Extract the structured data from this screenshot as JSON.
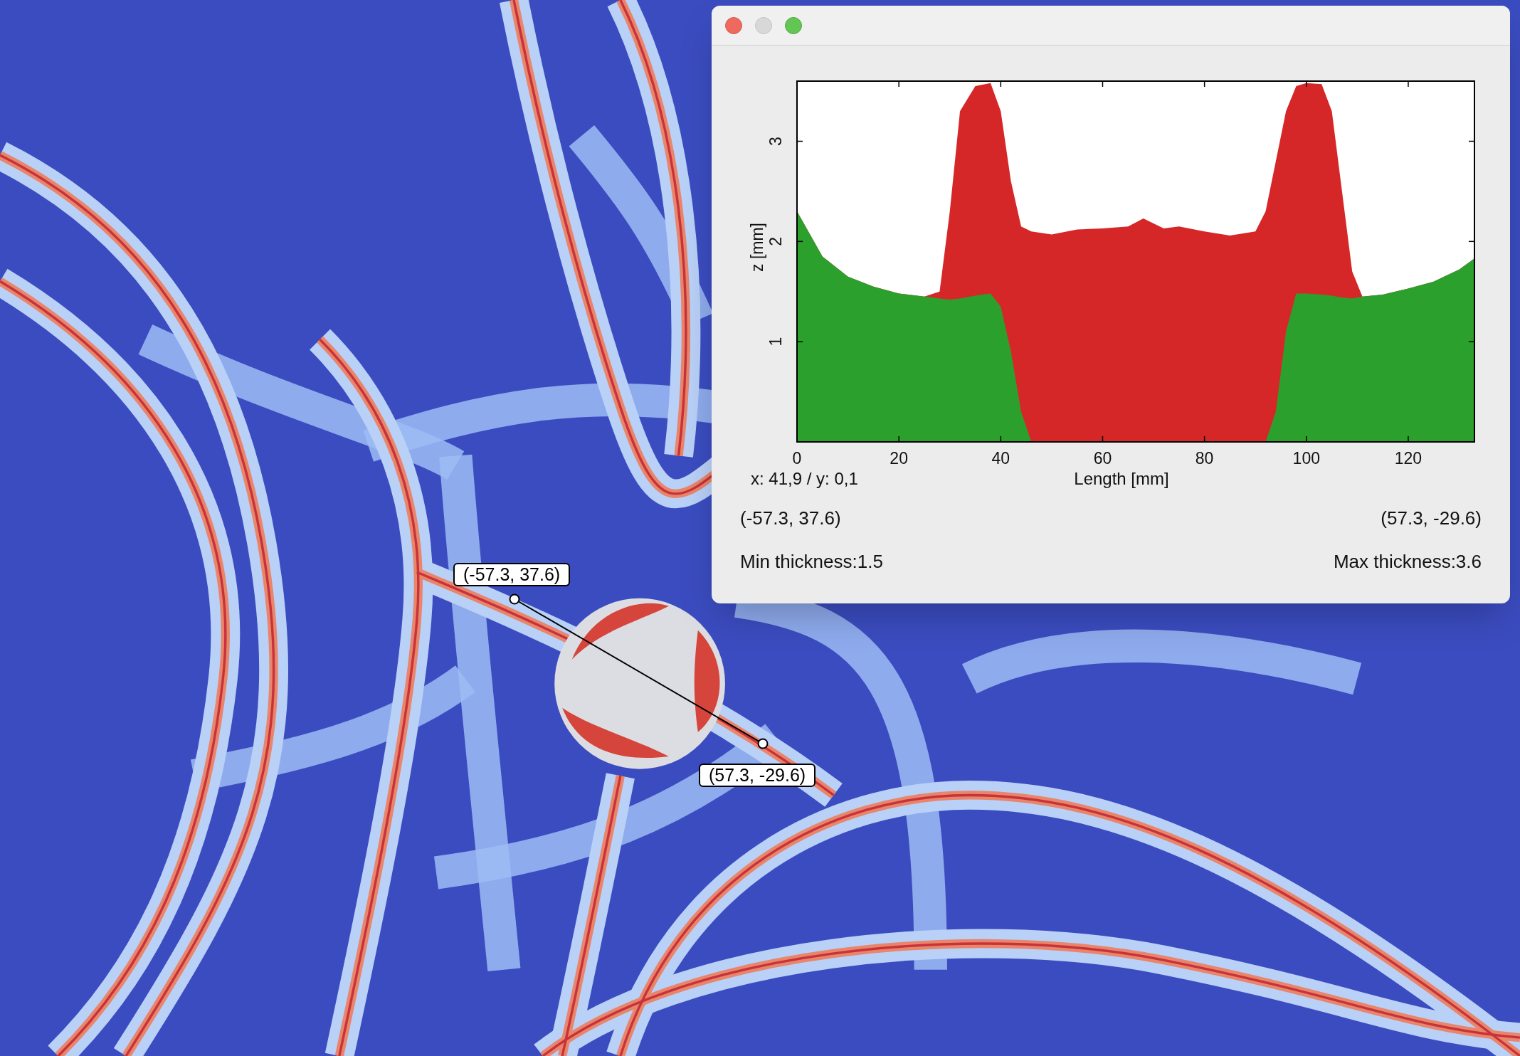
{
  "canvas": {
    "probe": {
      "start_label": "(-57.3, 37.6)",
      "end_label": "(57.3, -29.6)"
    }
  },
  "window": {
    "chart": {
      "chart_data": {
        "type": "area",
        "xlabel": "Length [mm]",
        "ylabel": "z [mm]",
        "xlim": [
          0,
          133
        ],
        "ylim": [
          0,
          3.6
        ],
        "xticks": [
          0,
          20,
          40,
          60,
          80,
          100,
          120
        ],
        "yticks": [
          1,
          2,
          3
        ],
        "x": [
          0,
          5,
          10,
          15,
          20,
          25,
          28,
          30,
          32,
          35,
          38,
          40,
          42,
          44,
          46,
          50,
          55,
          60,
          65,
          68,
          72,
          75,
          80,
          85,
          90,
          92,
          94,
          96,
          98,
          100,
          103,
          105,
          107,
          109,
          111,
          115,
          120,
          125,
          130,
          133
        ],
        "series": [
          {
            "color": "#d62728",
            "values": [
              2.3,
              1.85,
              1.65,
              1.55,
              1.48,
              1.45,
              1.5,
              2.3,
              3.3,
              3.55,
              3.58,
              3.3,
              2.6,
              2.15,
              2.1,
              2.07,
              2.12,
              2.13,
              2.15,
              2.23,
              2.13,
              2.15,
              2.1,
              2.06,
              2.1,
              2.3,
              2.8,
              3.3,
              3.55,
              3.58,
              3.57,
              3.3,
              2.5,
              1.7,
              1.45,
              1.47,
              1.53,
              1.6,
              1.72,
              1.83
            ]
          },
          {
            "color": "#2ca02c",
            "values": [
              2.3,
              1.85,
              1.65,
              1.55,
              1.48,
              1.45,
              1.43,
              1.42,
              1.43,
              1.46,
              1.48,
              1.35,
              0.9,
              0.3,
              0,
              0,
              0,
              0,
              0,
              0,
              0,
              0,
              0,
              0,
              0,
              0,
              0.3,
              1.1,
              1.48,
              1.48,
              1.47,
              1.46,
              1.44,
              1.43,
              1.45,
              1.47,
              1.53,
              1.6,
              1.72,
              1.83
            ]
          }
        ]
      }
    },
    "cursor_readout": "x: 41,9 / y: 0,1",
    "start_point": "(-57.3, 37.6)",
    "end_point": "(57.3, -29.6)",
    "min_thickness": "Min thickness:1.5",
    "max_thickness": "Max thickness:3.6"
  }
}
